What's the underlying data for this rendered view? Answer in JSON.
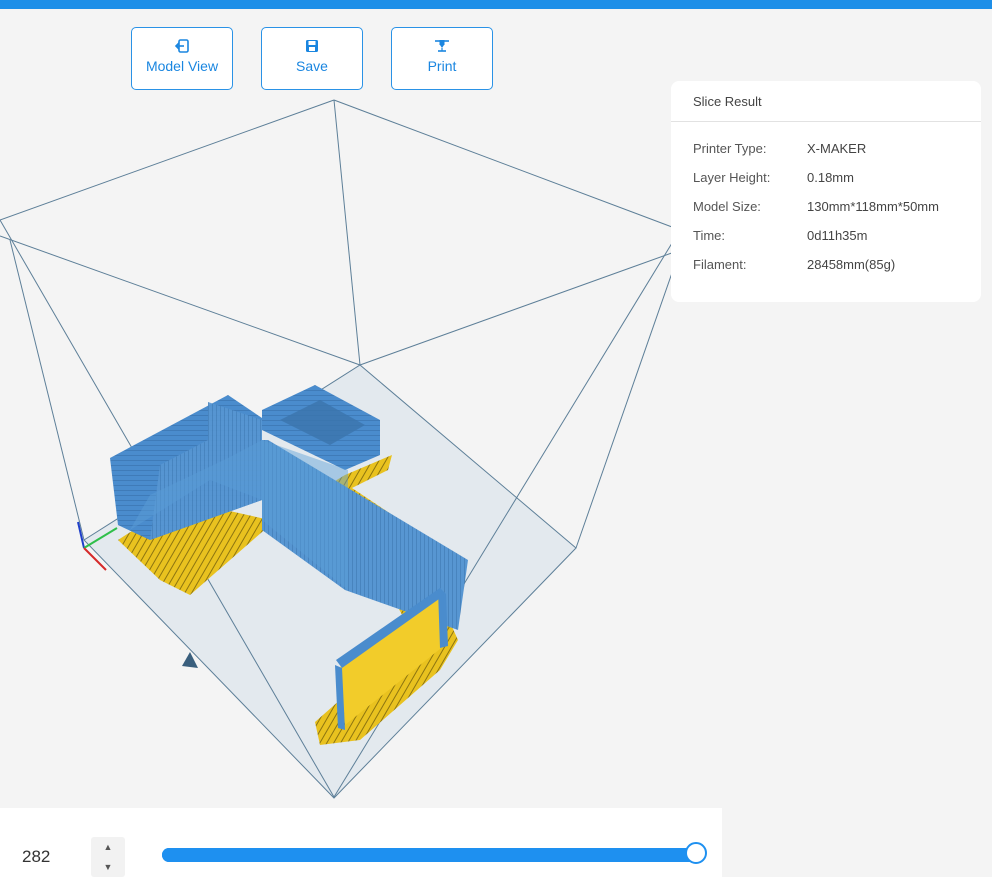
{
  "toolbar": {
    "model_view_label": "Model View",
    "save_label": "Save",
    "print_label": "Print",
    "icons": {
      "model_view": "exit-arrow-icon",
      "save": "floppy-disk-icon",
      "print": "printer-nozzle-icon"
    }
  },
  "slice_result": {
    "title": "Slice Result",
    "rows": [
      {
        "key": "Printer Type:",
        "value": "X-MAKER"
      },
      {
        "key": "Layer Height:",
        "value": "0.18mm"
      },
      {
        "key": "Model Size:",
        "value": "130mm*118mm*50mm"
      },
      {
        "key": "Time:",
        "value": "0d11h35m"
      },
      {
        "key": "Filament:",
        "value": "28458mm(85g)"
      }
    ]
  },
  "layer": {
    "current_value": "282",
    "slider_fraction": 1.0
  },
  "colors": {
    "accent": "#1e8fe8",
    "model_blue": "#4a88c7",
    "support_yellow": "#f2cc2a",
    "build_box_line": "#5d7f98"
  }
}
